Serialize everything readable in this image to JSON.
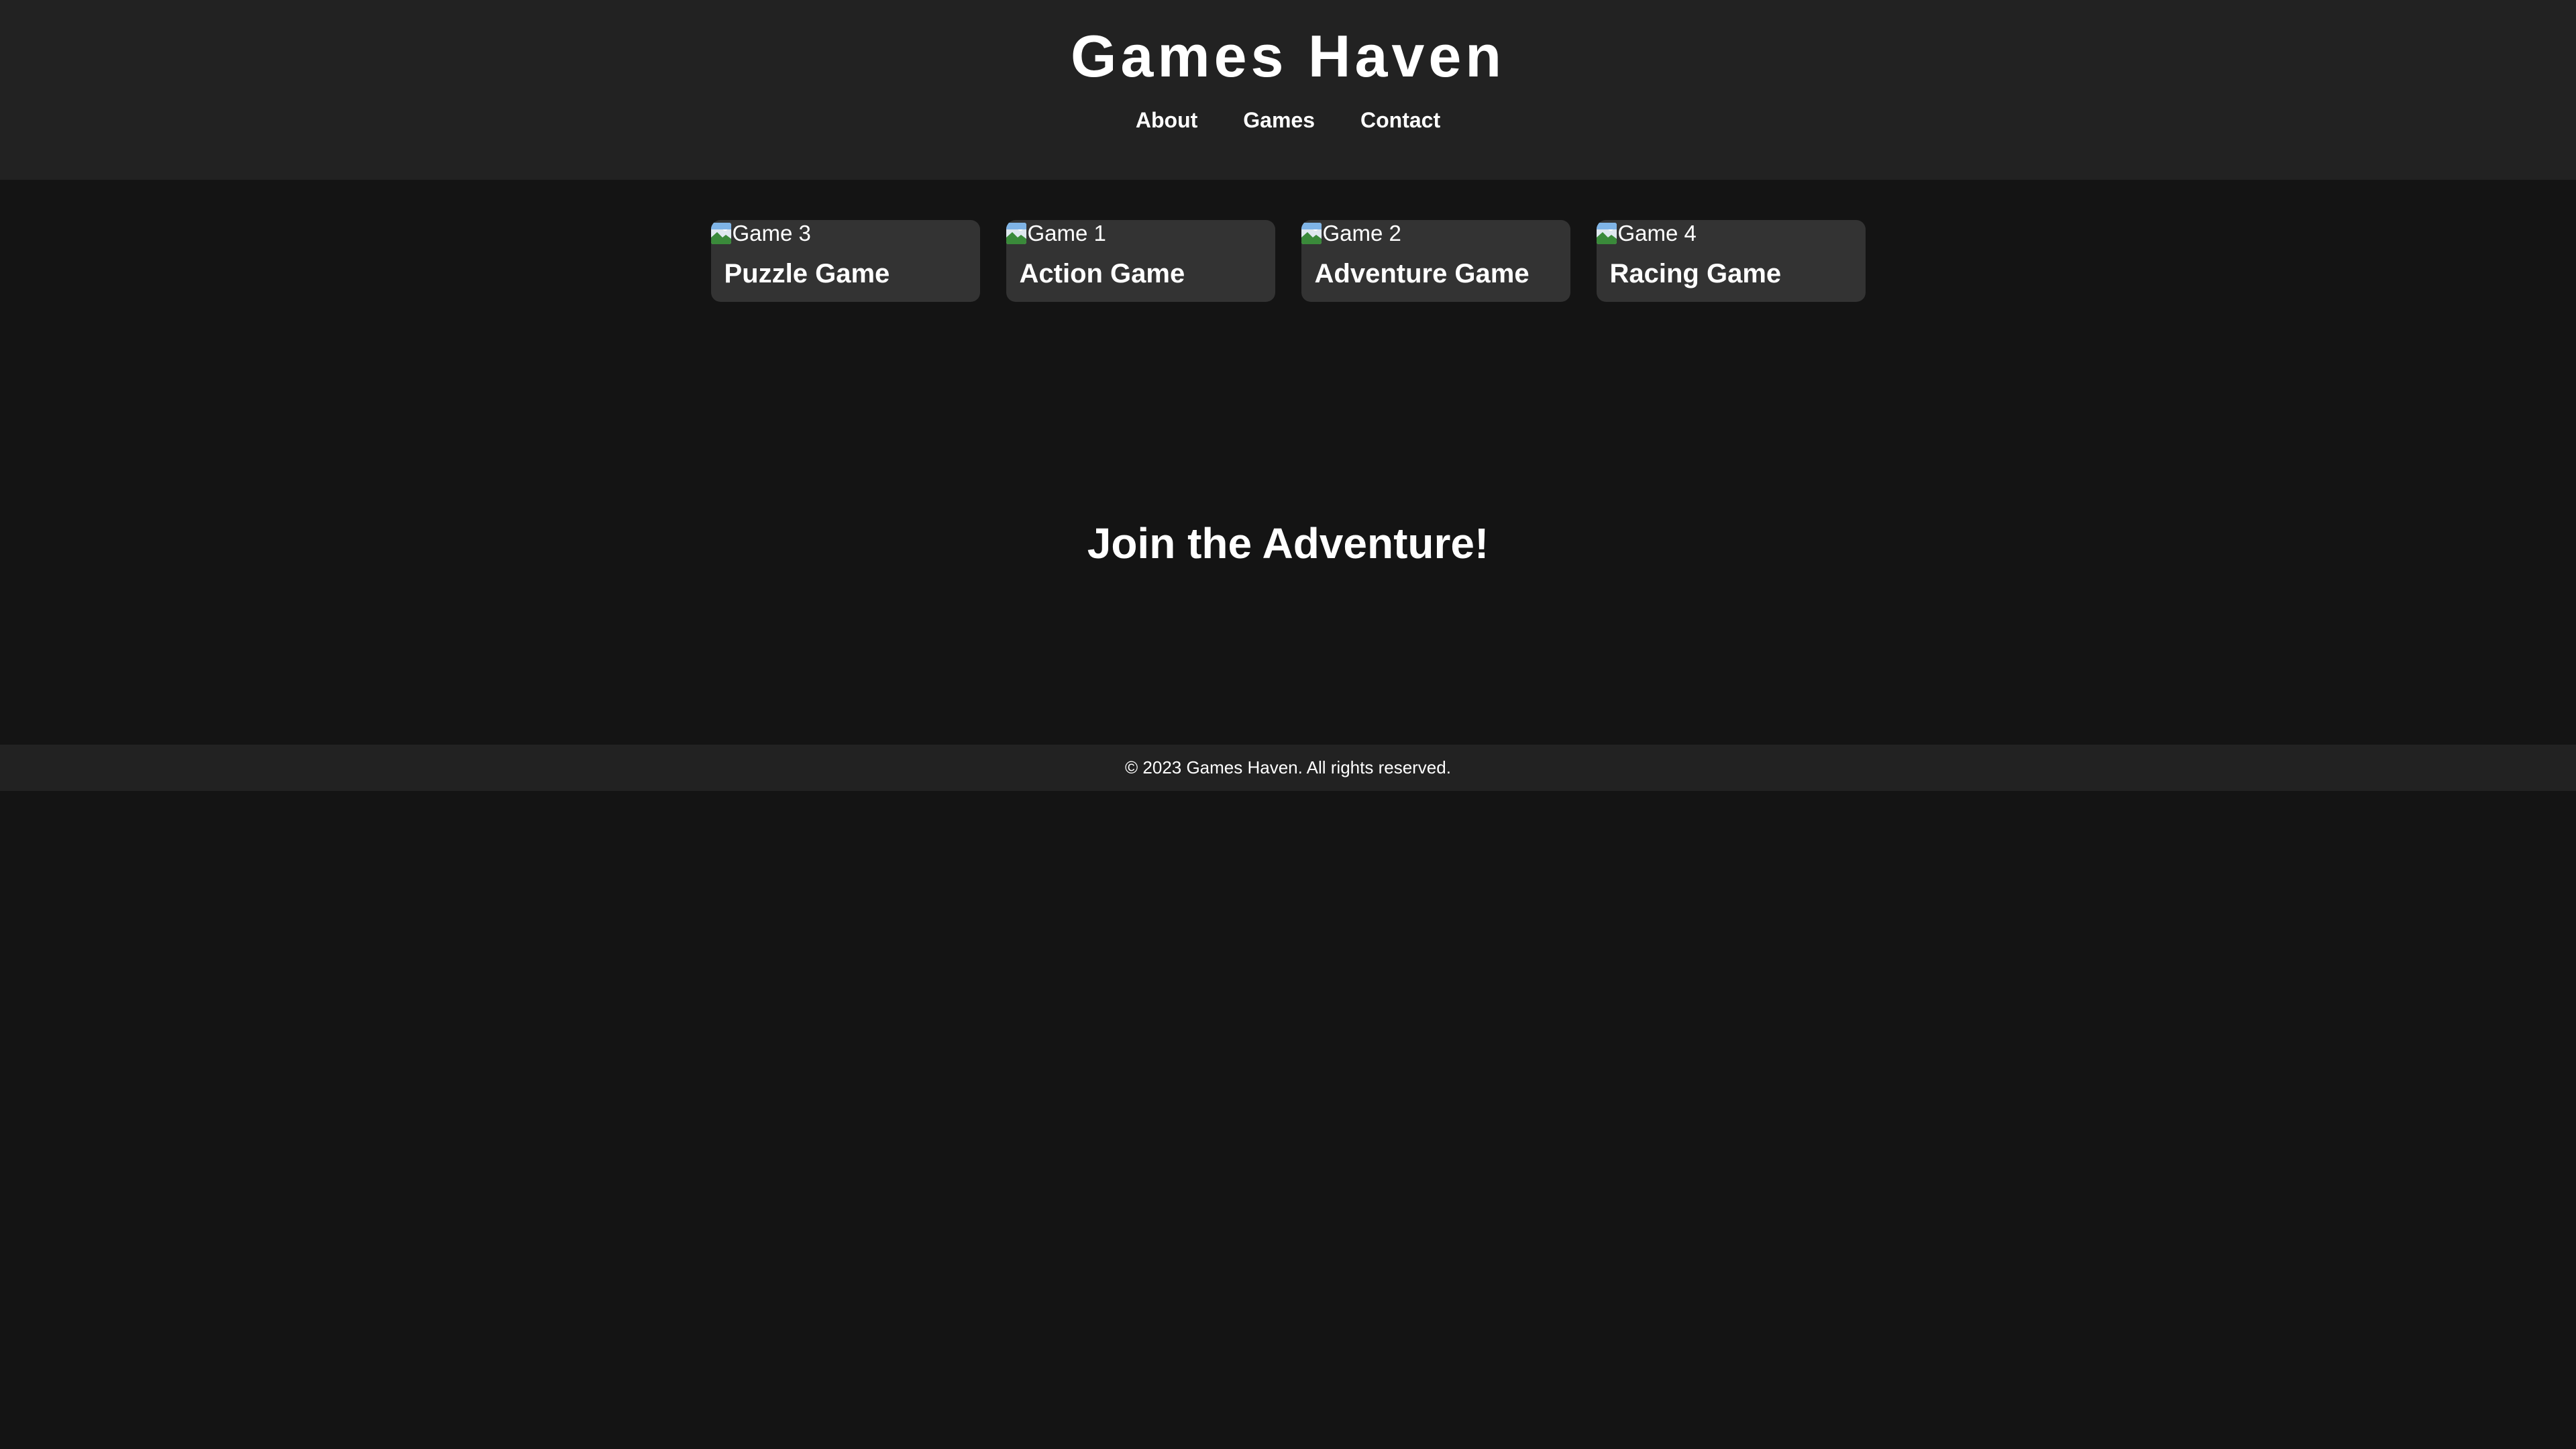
{
  "header": {
    "title": "Games Haven",
    "nav": [
      {
        "label": "About"
      },
      {
        "label": "Games"
      },
      {
        "label": "Contact"
      }
    ]
  },
  "games": [
    {
      "alt": "Game 3",
      "title": "Puzzle Game",
      "icon": "broken-image-icon"
    },
    {
      "alt": "Game 1",
      "title": "Action Game",
      "icon": "broken-image-icon"
    },
    {
      "alt": "Game 2",
      "title": "Adventure Game",
      "icon": "broken-image-icon"
    },
    {
      "alt": "Game 4",
      "title": "Racing Game",
      "icon": "broken-image-icon"
    }
  ],
  "hero": {
    "heading": "Join the Adventure!"
  },
  "footer": {
    "text": "© 2023 Games Haven. All rights reserved."
  },
  "colors": {
    "background": "#141414",
    "header_bg": "#222222",
    "card_bg": "#333333",
    "text": "#ffffff"
  }
}
